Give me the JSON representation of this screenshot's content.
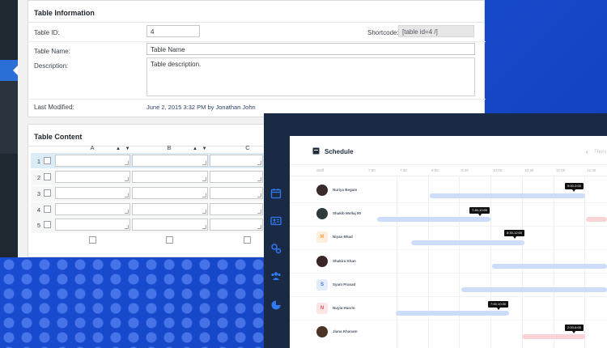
{
  "colors": {
    "brand_blue": "#1a4fd8",
    "bar_blue": "#cddcf8",
    "bar_pink": "#f9d4d4",
    "sidebar": "#1b2a44"
  },
  "table_info": {
    "heading": "Table Information",
    "id_label": "Table ID:",
    "id_value": "4",
    "shortcode_label": "Shortcode:",
    "shortcode_value": "[table id=4 /]",
    "name_label": "Table Name:",
    "name_value": "Table Name",
    "desc_label": "Description:",
    "desc_value": "Table description.",
    "modified_label": "Last Modified:",
    "modified_value": "June 2, 2015 3:32 PM by Jonathan John"
  },
  "table_content": {
    "heading": "Table Content",
    "columns": [
      "A",
      "B",
      "C"
    ],
    "sort_glyph": "▲ ▼",
    "rows": [
      "1",
      "2",
      "3",
      "4",
      "5"
    ]
  },
  "schedule": {
    "title": "Schedule",
    "nav_prev_icon": "chevron-left-icon",
    "nav_text": "Thurs",
    "times": [
      "Staff",
      "7:00",
      "7:30",
      "8:00",
      "8:30",
      "10:00",
      "10:30",
      "12:00",
      "12:30",
      "13:00",
      "13:30"
    ],
    "sidebar_icons": [
      "calendar-icon",
      "contact-card-icon",
      "services-icon",
      "group-icon",
      "pie-chart-icon"
    ],
    "staff": [
      {
        "name": "Nuriya Begam",
        "initial": "",
        "avatar": "photo",
        "tip": "9:00-2:00"
      },
      {
        "name": "Shakib Mollaj 90",
        "initial": "",
        "avatar": "photo",
        "tip": "7:45-10:00"
      },
      {
        "name": "Niyan Bhad",
        "initial": "M",
        "avatar": "letter",
        "tip": "8:30-12:00"
      },
      {
        "name": "Shakira Khan",
        "initial": "",
        "avatar": "photo",
        "tip": ""
      },
      {
        "name": "Syam Prasad",
        "initial": "S",
        "avatar": "letter",
        "tip": ""
      },
      {
        "name": "Nuyla Hasrin",
        "initial": "N",
        "avatar": "letter",
        "tip": "7:00-10:30"
      },
      {
        "name": "Jiana Khanam",
        "initial": "",
        "avatar": "photo",
        "tip": "2:00-6:00"
      }
    ]
  }
}
